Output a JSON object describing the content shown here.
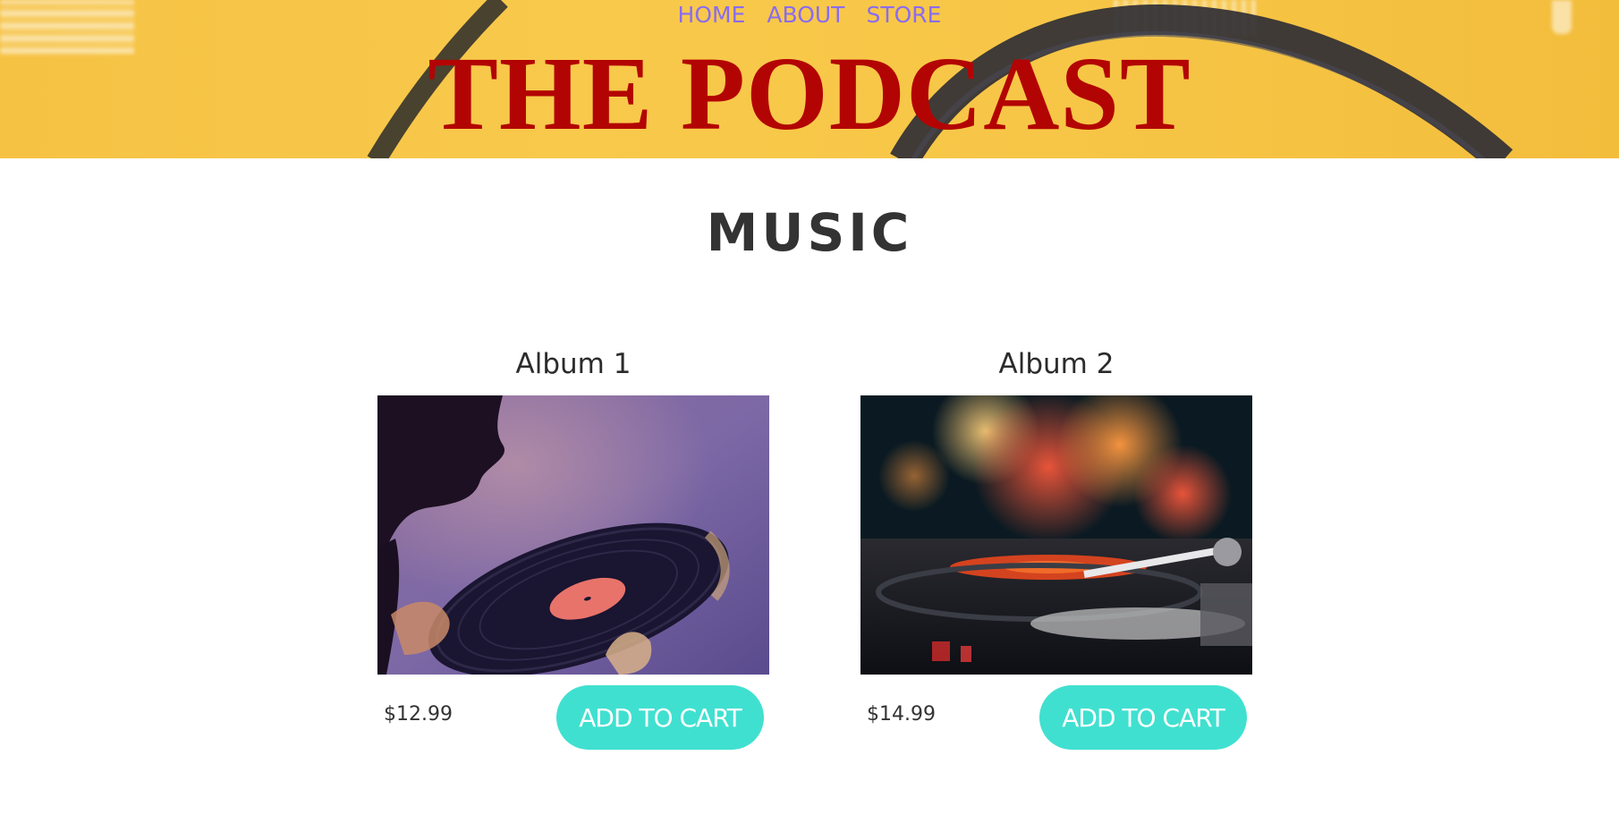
{
  "nav": {
    "items": [
      {
        "label": "HOME"
      },
      {
        "label": "ABOUT"
      },
      {
        "label": "STORE"
      }
    ]
  },
  "header": {
    "title": "THE PODCAST"
  },
  "music": {
    "title": "MUSIC",
    "albums": [
      {
        "name": "Album 1",
        "price": "$12.99",
        "button": "ADD TO CART"
      },
      {
        "name": "Album 2",
        "price": "$14.99",
        "button": "ADD TO CART"
      }
    ]
  },
  "colors": {
    "banner_bg": "#f7c647",
    "nav_link": "#8a6cf0",
    "title_red": "#b30404",
    "button_teal": "#40e0d0"
  }
}
